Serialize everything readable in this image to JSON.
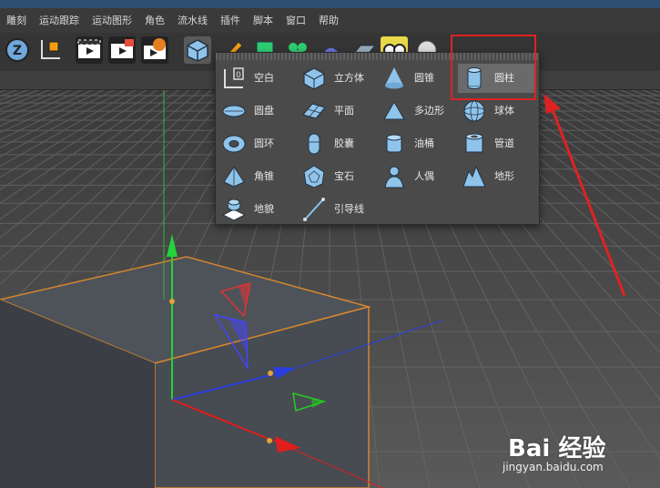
{
  "menubar": {
    "items": [
      "雕刻",
      "运动跟踪",
      "运动图形",
      "角色",
      "流水线",
      "插件",
      "脚本",
      "窗口",
      "帮助"
    ]
  },
  "toolbar": {
    "icons": [
      "z-axis-icon",
      "coordinate-icon",
      "render-view-icon",
      "render-picture-viewer-icon",
      "render-settings-icon",
      "cube-icon",
      "pen-icon",
      "subdivision-icon",
      "array-icon",
      "deformer-icon",
      "floor-icon",
      "camera-icon",
      "light-icon"
    ]
  },
  "popup": {
    "title": "",
    "items": [
      {
        "label": "空白",
        "icon": "null-icon"
      },
      {
        "label": "立方体",
        "icon": "cube-icon"
      },
      {
        "label": "圆锥",
        "icon": "cone-icon"
      },
      {
        "label": "圆柱",
        "icon": "cylinder-icon"
      },
      {
        "label": "圆盘",
        "icon": "disc-icon"
      },
      {
        "label": "平面",
        "icon": "plane-icon"
      },
      {
        "label": "多边形",
        "icon": "polygon-icon"
      },
      {
        "label": "球体",
        "icon": "sphere-icon"
      },
      {
        "label": "圆环",
        "icon": "torus-icon"
      },
      {
        "label": "胶囊",
        "icon": "capsule-icon"
      },
      {
        "label": "油桶",
        "icon": "oil-tank-icon"
      },
      {
        "label": "管道",
        "icon": "tube-icon"
      },
      {
        "label": "角锥",
        "icon": "pyramid-icon"
      },
      {
        "label": "宝石",
        "icon": "platonic-icon"
      },
      {
        "label": "人偶",
        "icon": "figure-icon"
      },
      {
        "label": "地形",
        "icon": "landscape-icon"
      },
      {
        "label": "地貌",
        "icon": "relief-icon"
      },
      {
        "label": "引导线",
        "icon": "guide-icon"
      }
    ],
    "selected": "圆柱"
  },
  "colors": {
    "accent_red": "#e02222",
    "axis_x": "#e01e1e",
    "axis_y": "#22d43a",
    "axis_z": "#2b3fe0",
    "selection_outline": "#d4862e",
    "icon_blue": "#8fc3ea"
  },
  "watermark": {
    "brand": "Bai 经验",
    "url": "jingyan.baidu.com"
  }
}
